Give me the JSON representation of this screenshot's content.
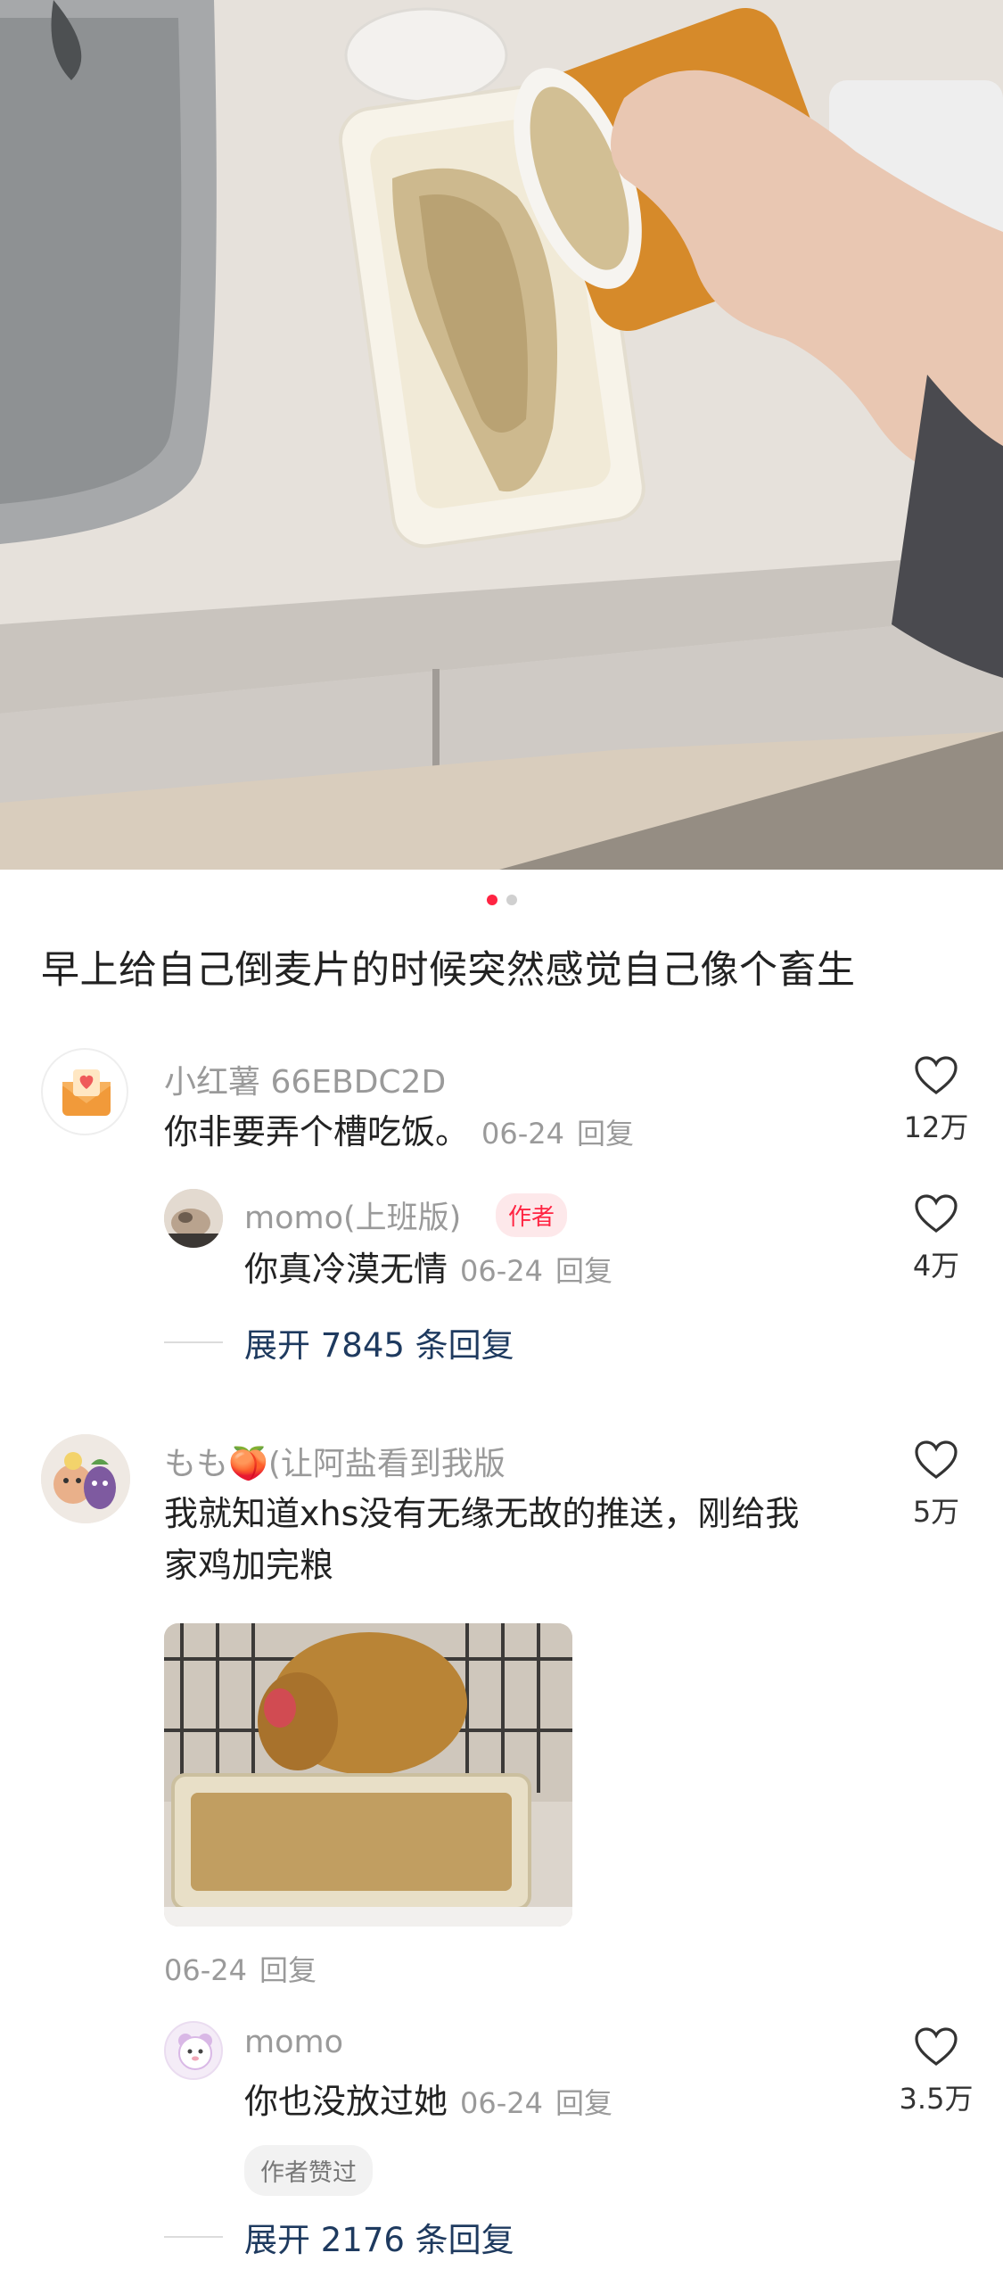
{
  "gallery": {
    "total_pages": 2,
    "current_page": 1
  },
  "post": {
    "title": "早上给自己倒麦片的时候突然感觉自己像个畜生"
  },
  "comments": [
    {
      "user": "小红薯 66EBDC2D",
      "text": "你非要弄个槽吃饭。",
      "date": "06-24",
      "reply_label": "回复",
      "likes": "12万",
      "replies": [
        {
          "user": "momo(上班版)",
          "badge": "作者",
          "text": "你真冷漠无情",
          "date": "06-24",
          "reply_label": "回复",
          "likes": "4万"
        }
      ],
      "expand_text": "展开 7845 条回复"
    },
    {
      "user": "もも🍑(让阿盐看到我版",
      "text_line1": "我就知道xhs没有无缘无故的推送，刚给我",
      "text_line2": "家鸡加完粮",
      "date": "06-24",
      "reply_label": "回复",
      "likes": "5万",
      "replies": [
        {
          "user": "momo",
          "text": "你也没放过她",
          "date": "06-24",
          "reply_label": "回复",
          "likes": "3.5万",
          "tag": "作者赞过"
        }
      ],
      "expand_text": "展开 2176 条回复"
    }
  ],
  "icons": {
    "like": "heart-outline-icon",
    "avatar1": "envelope-heart-icon",
    "avatar2": "cat-photo-avatar",
    "avatar3": "figures-sticker-avatar",
    "avatar4": "cartoon-bear-avatar"
  },
  "colors": {
    "accent": "#ff2442",
    "link": "#1e3a5f",
    "muted": "#9a9a9a"
  }
}
